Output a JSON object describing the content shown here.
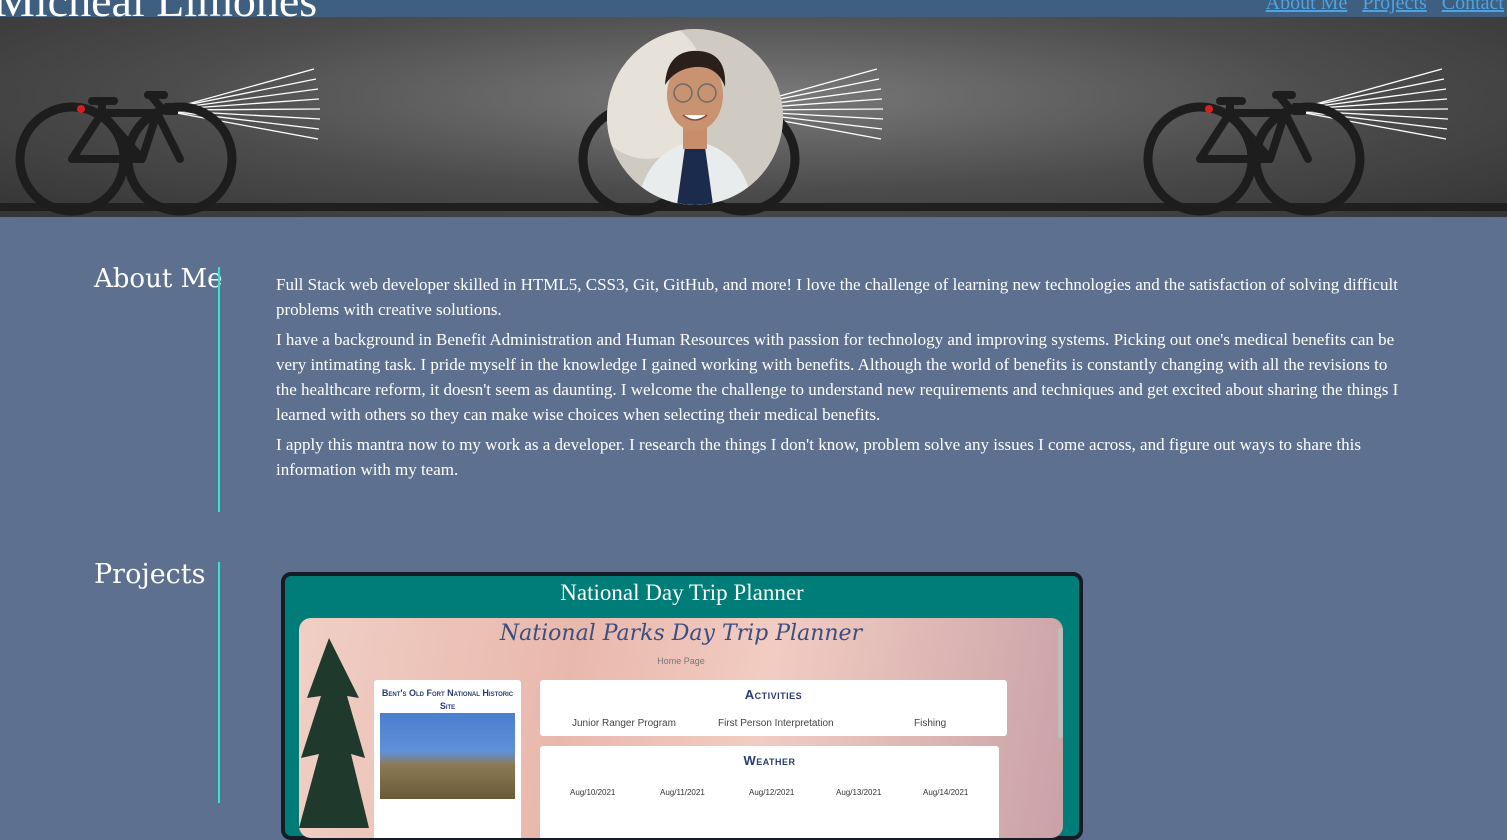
{
  "header": {
    "site_name": "Micheal Limones",
    "nav": [
      "About Me",
      "Projects",
      "Contact"
    ]
  },
  "colors": {
    "topbar": "#3e5f80",
    "page_background": "#5e708f",
    "accent_line": "#2ee6d3",
    "nav_link": "#4ea3e0",
    "project_card": "#007d78"
  },
  "hero": {
    "banner_icon": "bicycle-icon",
    "profile_photo": "avatar"
  },
  "about": {
    "title": "About Me",
    "paragraphs": [
      "Full Stack web developer skilled in HTML5, CSS3, Git, GitHub, and more! I love the challenge of learning new technologies and the satisfaction of solving difficult problems with creative solutions.",
      "I have a background in Benefit Administration and Human Resources with passion for technology and improving systems. Picking out one's medical benefits can be very intimating task. I pride myself in the knowledge I gained working with benefits. Although the world of benefits is constantly changing with all the revisions to the healthcare reform, it doesn't seem as daunting. I welcome the challenge to understand new requirements and techniques and get excited about sharing the things I learned with others so they can make wise choices when selecting their medical benefits.",
      "I apply this mantra now to my work as a developer. I research the things I don't know, problem solve any issues I come across, and figure out ways to share this information with my team."
    ]
  },
  "projects": {
    "title": "Projects",
    "items": [
      {
        "title": "National Day Trip Planner",
        "screenshot": {
          "app_title": "National Parks Day Trip Planner",
          "subtitle": "Home Page",
          "park_name": "Bent's Old Fort National Historic Site",
          "activities_heading": "Activities",
          "activities": [
            "Junior Ranger Program",
            "First Person Interpretation",
            "Fishing"
          ],
          "weather_heading": "Weather",
          "weather_days": [
            "Aug/10/2021",
            "Aug/11/2021",
            "Aug/12/2021",
            "Aug/13/2021",
            "Aug/14/2021"
          ]
        }
      }
    ]
  }
}
